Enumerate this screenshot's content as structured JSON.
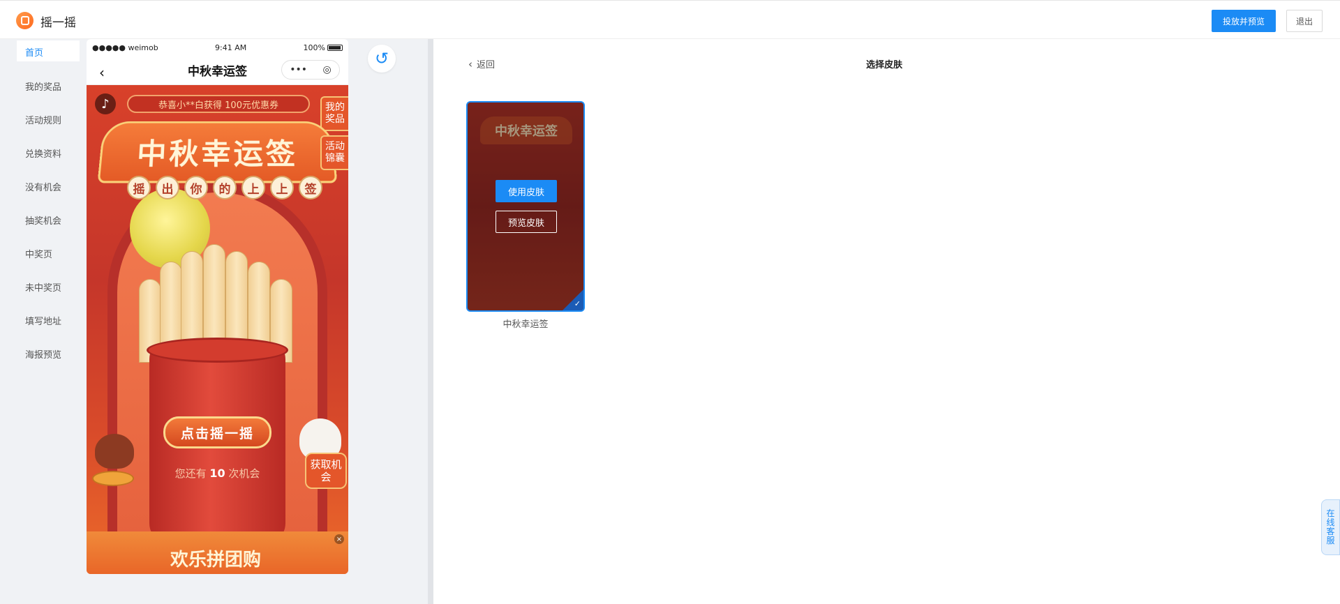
{
  "app": {
    "title": "摇一摇"
  },
  "header": {
    "publish_label": "投放并预览",
    "exit_label": "退出"
  },
  "nav": {
    "items": [
      "首页",
      "我的奖品",
      "活动规则",
      "兑换资料",
      "没有机会",
      "抽奖机会",
      "中奖页",
      "未中奖页",
      "填写地址",
      "海报预览"
    ],
    "active_index": 0
  },
  "phone": {
    "status": {
      "carrier": "●●●●● weimob",
      "time": "9:41 AM",
      "battery": "100%"
    },
    "title": "中秋幸运签",
    "capsule": {
      "more": "•••",
      "close": "◎"
    },
    "notice": "恭喜小**白获得 100元优惠券",
    "ribbon_title": "中秋幸运签",
    "balls": [
      "摇",
      "出",
      "你",
      "的",
      "上",
      "上",
      "签"
    ],
    "my_prizes_badge": "我的奖品",
    "rules_badge": "活动锦囊",
    "shake_button": "点击摇一摇",
    "chances_prefix": "您还有 ",
    "chances_count": "10",
    "chances_suffix": " 次机会",
    "get_chance_badge": "获取机会",
    "bottom_banner": "欢乐拼团购",
    "close": "×"
  },
  "undo_icon": "↺",
  "panel": {
    "back_label": "返回",
    "title": "选择皮肤",
    "skins": [
      {
        "name": "中秋幸运签",
        "use_label": "使用皮肤",
        "preview_label": "预览皮肤",
        "selected": true
      }
    ]
  },
  "service": {
    "label": "在线客服"
  },
  "colors": {
    "primary": "#1b8bf5",
    "background": "#f0f2f5"
  }
}
